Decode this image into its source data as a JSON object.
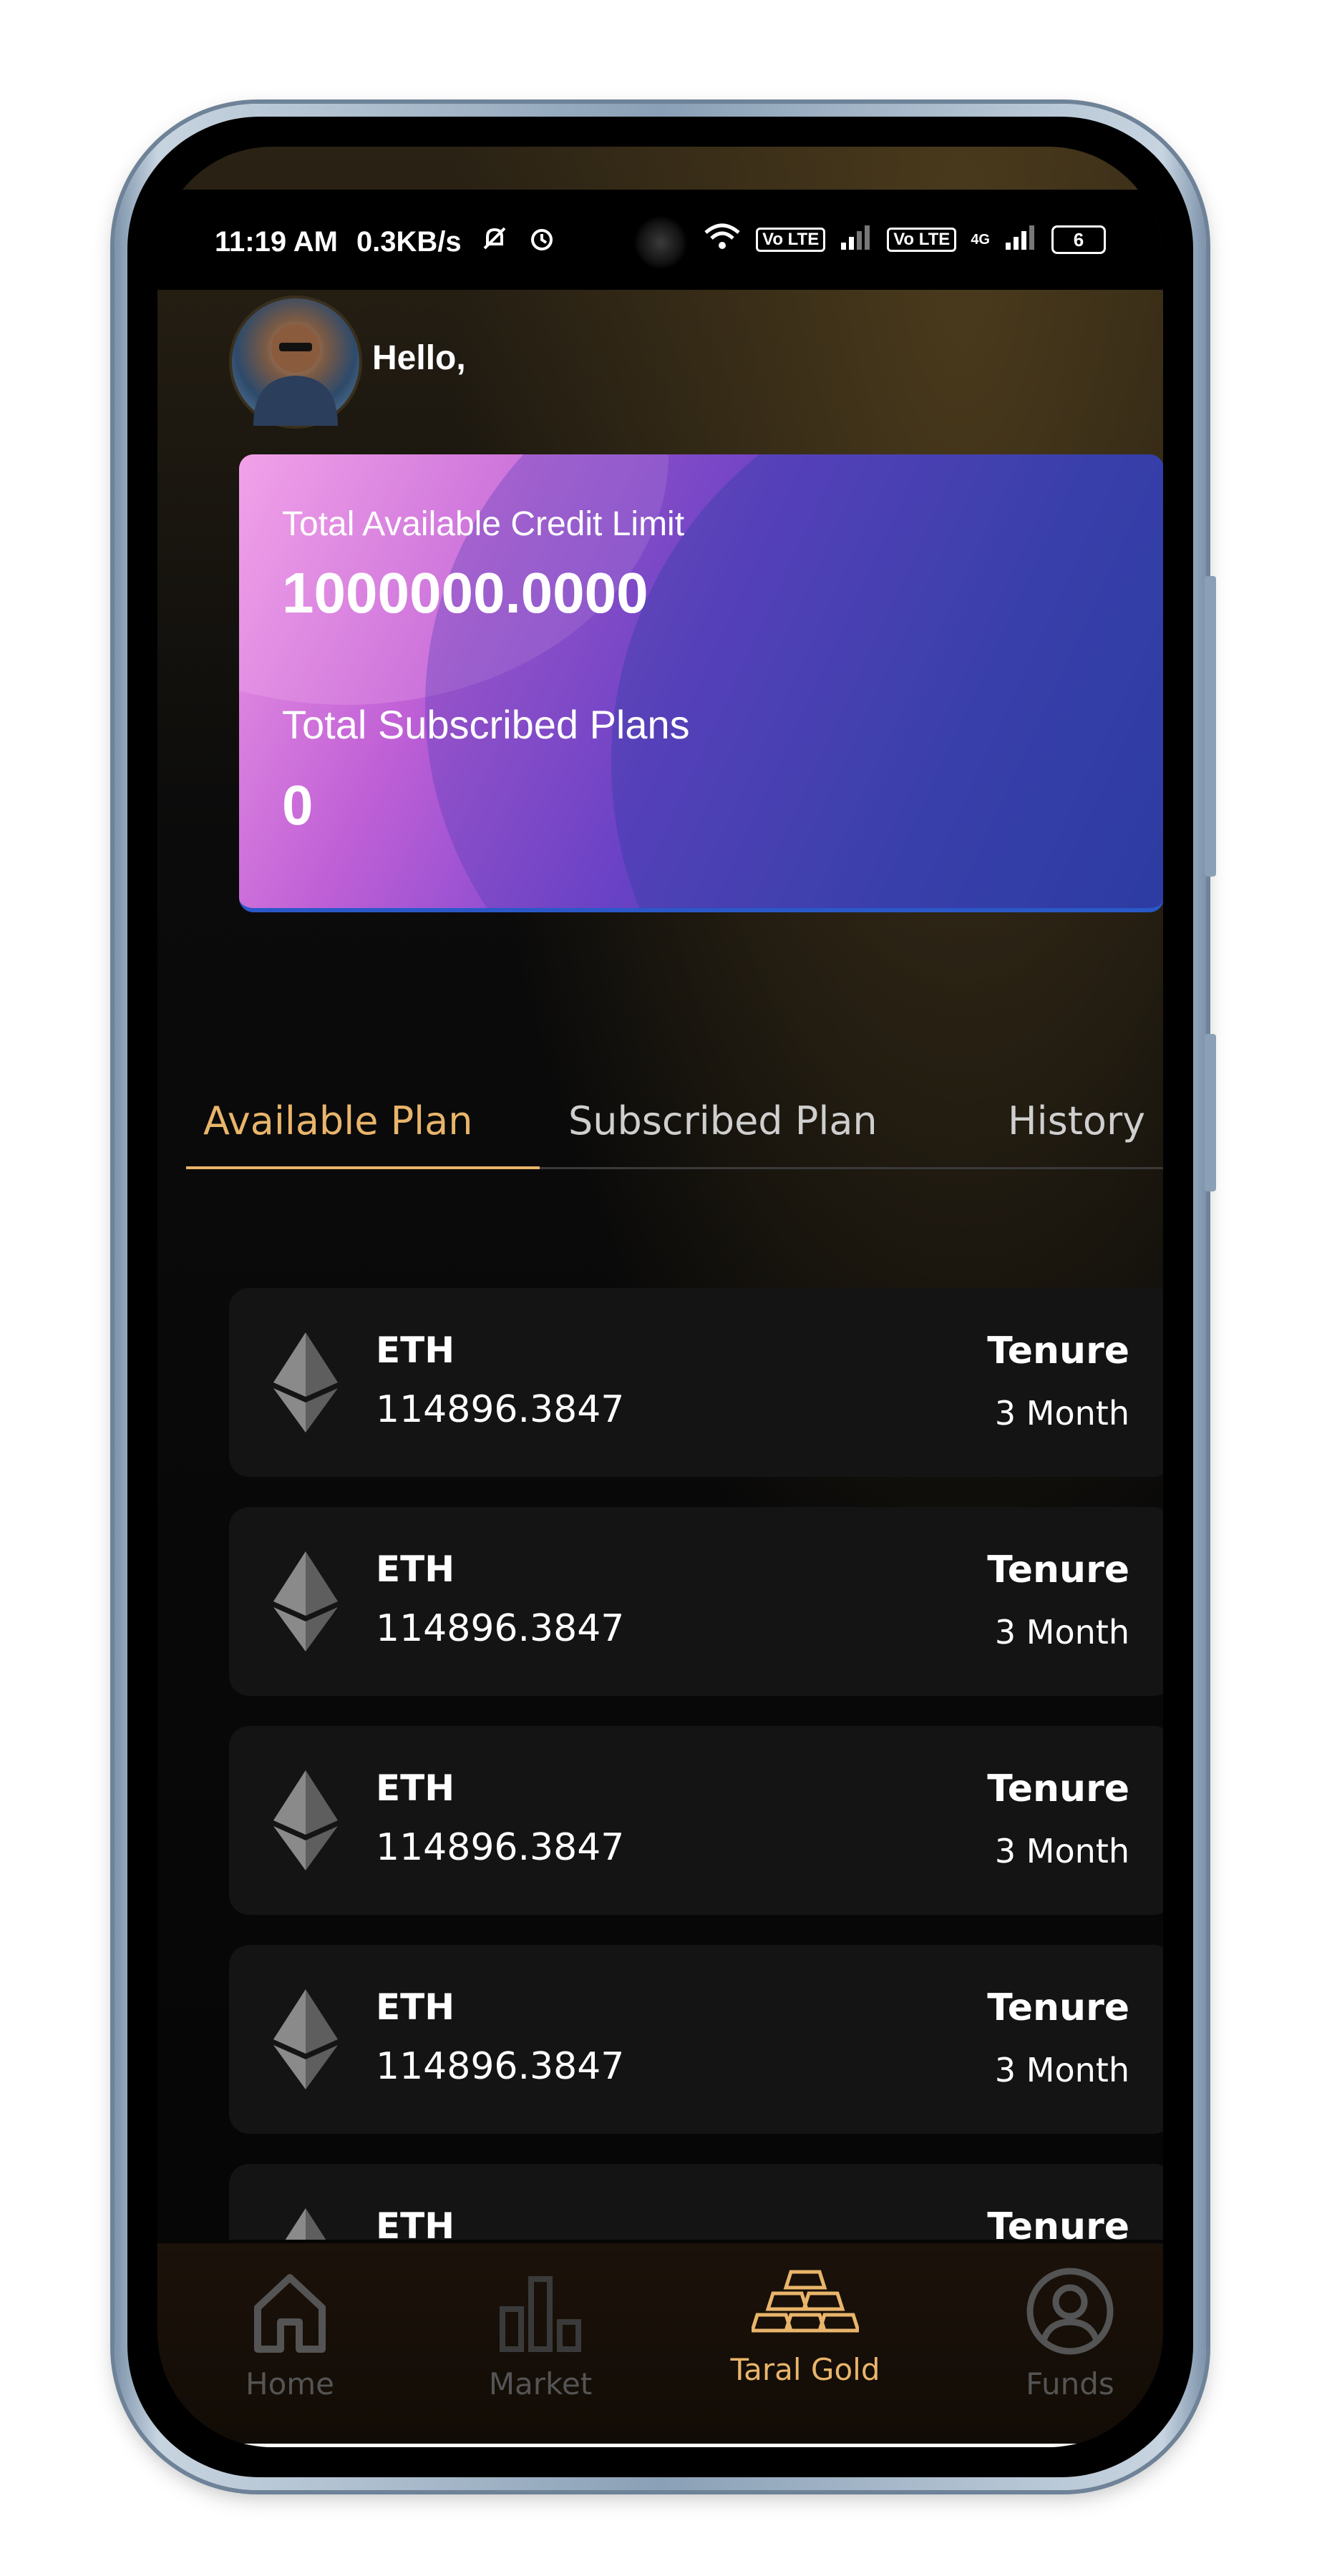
{
  "status_bar": {
    "time": "11:19 AM",
    "network_speed": "0.3KB/s",
    "sim1": "Vo LTE",
    "sim2": "Vo LTE",
    "net_type": "4G",
    "battery": "6"
  },
  "header": {
    "greeting": "Hello,"
  },
  "credit_card": {
    "limit_label": "Total Available Credit Limit",
    "limit_value": "1000000.0000",
    "plans_label": "Total Subscribed Plans",
    "plans_value": "0"
  },
  "tabs": [
    {
      "label": "Available Plan",
      "active": true
    },
    {
      "label": "Subscribed Plan",
      "active": false
    },
    {
      "label": "History",
      "active": false
    }
  ],
  "plans": [
    {
      "coin": "ETH",
      "amount": "114896.3847",
      "tenure_label": "Tenure",
      "duration": "3 Month",
      "icon": "ethereum-icon"
    },
    {
      "coin": "ETH",
      "amount": "114896.3847",
      "tenure_label": "Tenure",
      "duration": "3 Month",
      "icon": "ethereum-icon"
    },
    {
      "coin": "ETH",
      "amount": "114896.3847",
      "tenure_label": "Tenure",
      "duration": "3 Month",
      "icon": "ethereum-icon"
    },
    {
      "coin": "ETH",
      "amount": "114896.3847",
      "tenure_label": "Tenure",
      "duration": "3 Month",
      "icon": "ethereum-icon"
    },
    {
      "coin": "ETH",
      "amount": "",
      "tenure_label": "Tenure",
      "duration": "",
      "icon": "ethereum-icon"
    }
  ],
  "bottom_nav": [
    {
      "label": "Home",
      "icon": "home-icon",
      "active": false
    },
    {
      "label": "Market",
      "icon": "bar-chart-icon",
      "active": false
    },
    {
      "label": "Taral Gold",
      "icon": "gold-bars-icon",
      "active": true
    },
    {
      "label": "Funds",
      "icon": "user-circle-icon",
      "active": false
    }
  ],
  "colors": {
    "accent": "#e9b56b",
    "background": "#0b0b0b",
    "card_bg": "#141414"
  }
}
